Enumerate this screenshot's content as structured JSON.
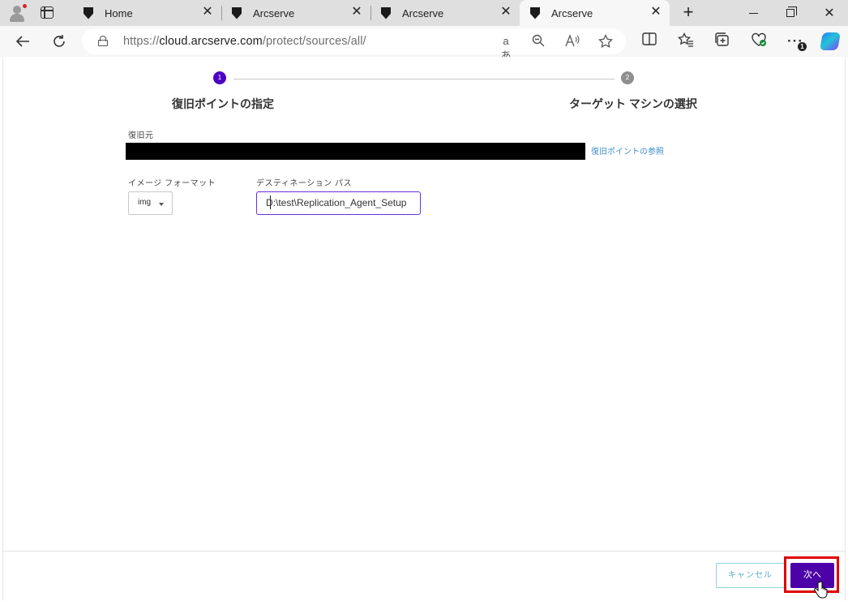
{
  "browser": {
    "tabs": [
      {
        "title": "Home"
      },
      {
        "title": "Arcserve"
      },
      {
        "title": "Arcserve"
      },
      {
        "title": "Arcserve"
      }
    ],
    "tab_close_glyph": "✕",
    "new_tab_glyph": "+",
    "url_scheme": "https://",
    "url_domain": "cloud.arcserve.com",
    "url_path": "/protect/sources/all/",
    "read_aloud_label": "aあ",
    "extensions_badge": "1",
    "window_controls": {
      "close": "✕"
    }
  },
  "wizard": {
    "steps": [
      {
        "number": "1",
        "label": "復旧ポイントの指定",
        "state": "active"
      },
      {
        "number": "2",
        "label": "ターゲット マシンの選択",
        "state": "inactive"
      }
    ],
    "source_label": "復旧元",
    "browse_link": "復旧ポイントの参照",
    "image_format_label": "イメージ フォーマット",
    "image_format_value": "img",
    "destination_label": "デスティネーション パス",
    "destination_value": "D:\\test\\Replication_Agent_Setup",
    "cancel_label": "キャンセル",
    "next_label": "次へ"
  },
  "colors": {
    "primary": "#4c00a8",
    "step_active": "#4c00c2",
    "link": "#3f8ec9",
    "highlight": "#e00000"
  }
}
